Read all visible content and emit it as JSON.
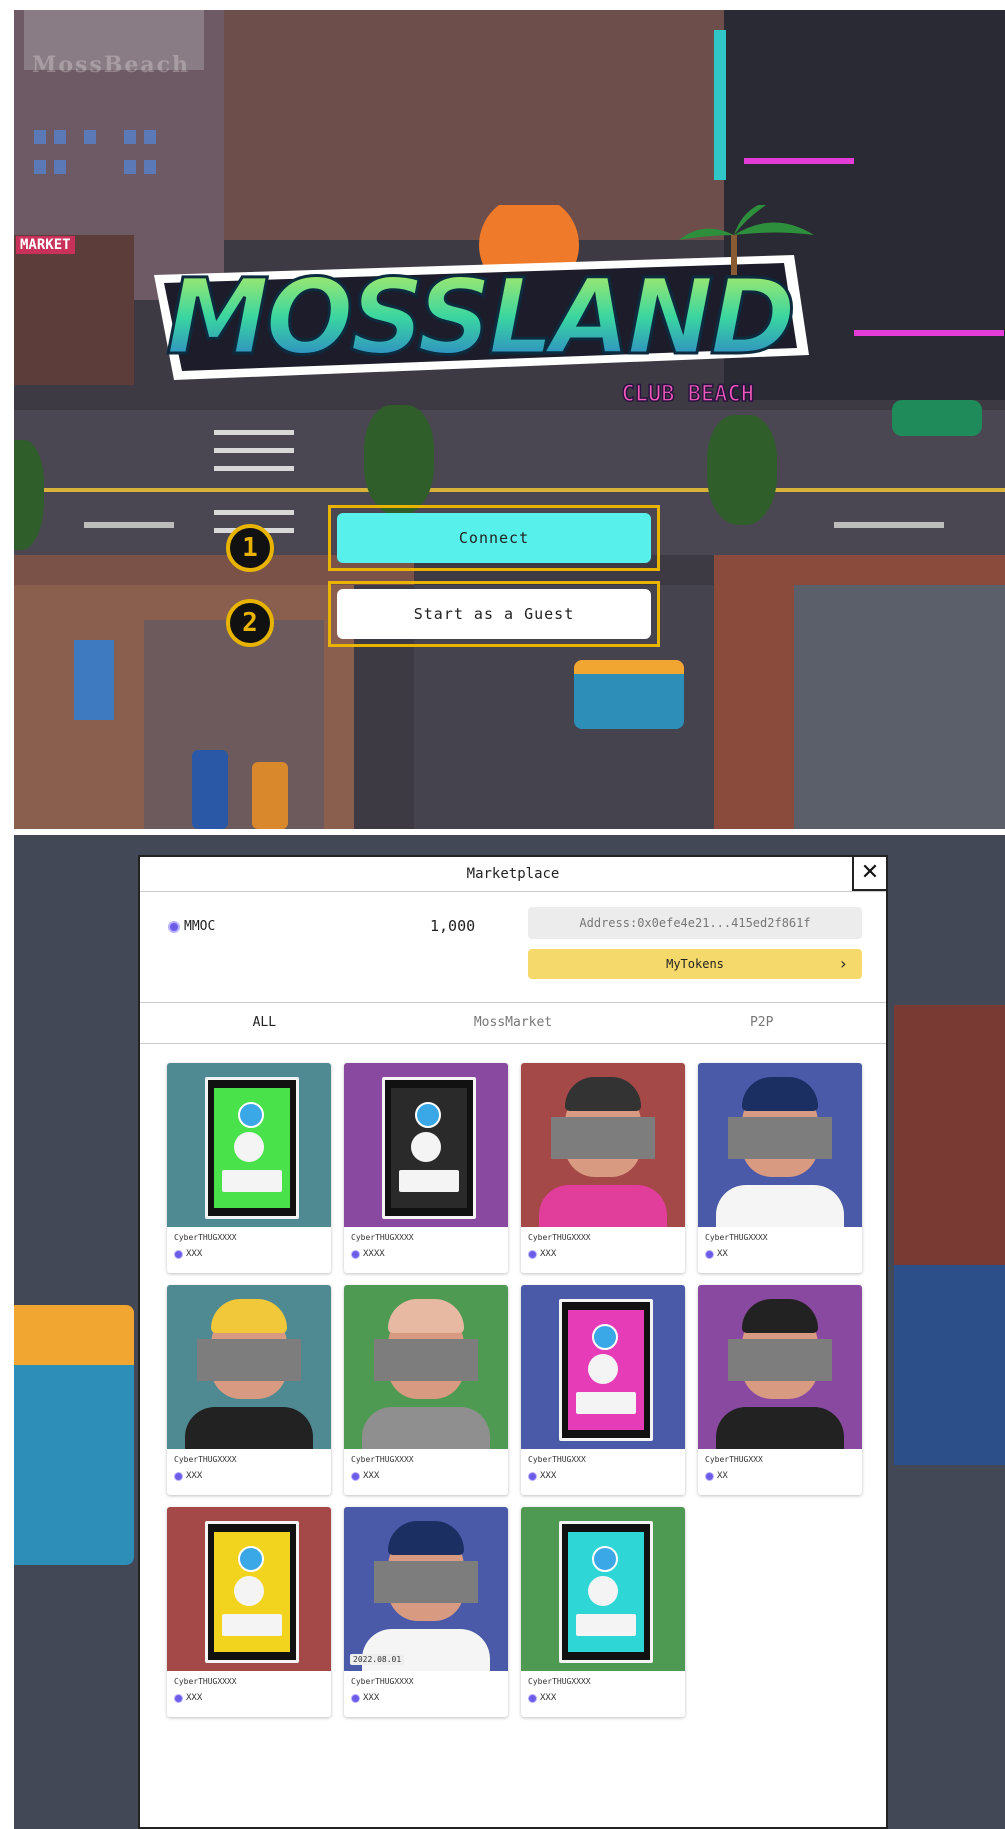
{
  "game": {
    "logo_watermark": "MossBeach",
    "market_sign": "MARKET",
    "logo_text": "MOSSLAND",
    "logo_subtext": "CLUB BEACH",
    "steps": [
      {
        "number": "1",
        "label": "Connect"
      },
      {
        "number": "2",
        "label": "Start as a Guest"
      }
    ]
  },
  "marketplace": {
    "title": "Marketplace",
    "close_label": "✕",
    "currency": "MMOC",
    "balance": "1,000",
    "address": "Address:0x0efe4e21...415ed2f861f",
    "mytokens_label": "MyTokens",
    "mytokens_chevron": "›",
    "tabs": [
      {
        "label": "ALL",
        "active": true
      },
      {
        "label": "MossMarket",
        "active": false
      },
      {
        "label": "P2P",
        "active": false
      }
    ],
    "items": [
      {
        "name": "CyberTHUGXXXX",
        "price": "XXX",
        "bg": "#4f8a93",
        "kind": "pack",
        "pack": "#49e24a"
      },
      {
        "name": "CyberTHUGXXXX",
        "price": "XXXX",
        "bg": "#8a49a0",
        "kind": "pack",
        "pack": "#2a2a2a"
      },
      {
        "name": "CyberTHUGXXXX",
        "price": "XXX",
        "bg": "#a54848",
        "kind": "avatar",
        "shirt": "#e13d9a",
        "hair": "#333"
      },
      {
        "name": "CyberTHUGXXXX",
        "price": "XX",
        "bg": "#4b5aa8",
        "kind": "avatar",
        "shirt": "#f5f5f5",
        "hair": "#1c2f63"
      },
      {
        "name": "CyberTHUGXXXX",
        "price": "XXX",
        "bg": "#4f8a93",
        "kind": "avatar",
        "shirt": "#222",
        "hair": "#f0c83a"
      },
      {
        "name": "CyberTHUGXXXX",
        "price": "XXX",
        "bg": "#4f9a52",
        "kind": "avatar",
        "shirt": "#8f8f8f",
        "hair": "#e7b8a2"
      },
      {
        "name": "CyberTHUGXXX",
        "price": "XXX",
        "bg": "#4b5aa8",
        "kind": "pack",
        "pack": "#e63cb8"
      },
      {
        "name": "CyberTHUGXXX",
        "price": "XX",
        "bg": "#8a49a0",
        "kind": "avatar",
        "shirt": "#222",
        "hair": "#222"
      },
      {
        "name": "CyberTHUGXXXX",
        "price": "XXX",
        "bg": "#a54848",
        "kind": "pack",
        "pack": "#f2d41e"
      },
      {
        "name": "CyberTHUGXXXX",
        "price": "XXX",
        "bg": "#4b5aa8",
        "kind": "avatar",
        "shirt": "#f5f5f5",
        "hair": "#1c2f63",
        "date": "2022.08.01"
      },
      {
        "name": "CyberTHUGXXXX",
        "price": "XXX",
        "bg": "#4f9a52",
        "kind": "pack",
        "pack": "#2ed6d6"
      }
    ]
  },
  "colors": {
    "accent_yellow": "#e8b400",
    "connect_cyan": "#58f0ea",
    "mytokens_yellow": "#f6d96b",
    "coin_purple": "#6c5ce7"
  }
}
